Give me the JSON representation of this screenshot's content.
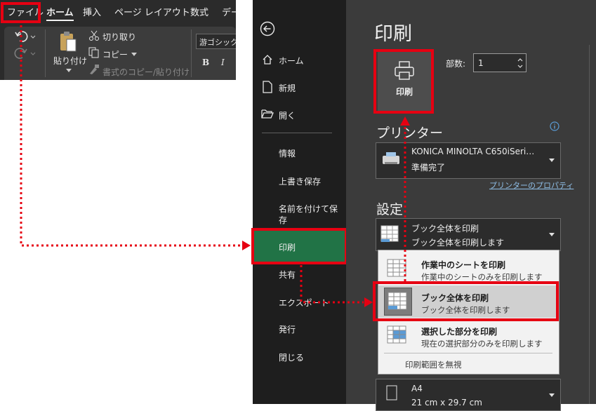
{
  "ribbon": {
    "tabs": [
      "ファイル",
      "ホーム",
      "挿入",
      "ページ レイアウト",
      "数式",
      "デー"
    ],
    "clipboard": {
      "paste": "貼り付け",
      "cut": "切り取り",
      "copy": "コピー",
      "format_painter": "書式のコピー/貼り付け"
    },
    "font": {
      "name": "游ゴシック",
      "bold": "B",
      "italic": "I"
    }
  },
  "backstage": {
    "nav": {
      "home": "ホーム",
      "new": "新規",
      "open": "開く",
      "info": "情報",
      "save": "上書き保存",
      "save_as_line1": "名前を付けて保",
      "save_as_line2": "存",
      "print": "印刷",
      "share": "共有",
      "export": "エクスポート",
      "publish": "発行",
      "close": "閉じる"
    },
    "print_pane": {
      "title": "印刷",
      "print_button": "印刷",
      "copies_label": "部数:",
      "copies_value": "1",
      "printer_heading": "プリンター",
      "printer_name": "KONICA MINOLTA C650iSeri…",
      "printer_status": "準備完了",
      "printer_properties": "プリンターのプロパティ",
      "settings_heading": "設定",
      "scope_selected_title": "ブック全体を印刷",
      "scope_selected_sub": "ブック全体を印刷します",
      "menu": [
        {
          "title": "作業中のシートを印刷",
          "sub": "作業中のシートのみを印刷します"
        },
        {
          "title": "ブック全体を印刷",
          "sub": "ブック全体を印刷します"
        },
        {
          "title": "選択した部分を印刷",
          "sub": "現在の選択部分のみを印刷します"
        }
      ],
      "ignore_print_area": "印刷範囲を無視",
      "paper_size": "A4",
      "paper_dims": "21 cm x 29.7 cm"
    }
  },
  "colors": {
    "highlight": "#e60012",
    "print_nav_active": "#217346"
  }
}
